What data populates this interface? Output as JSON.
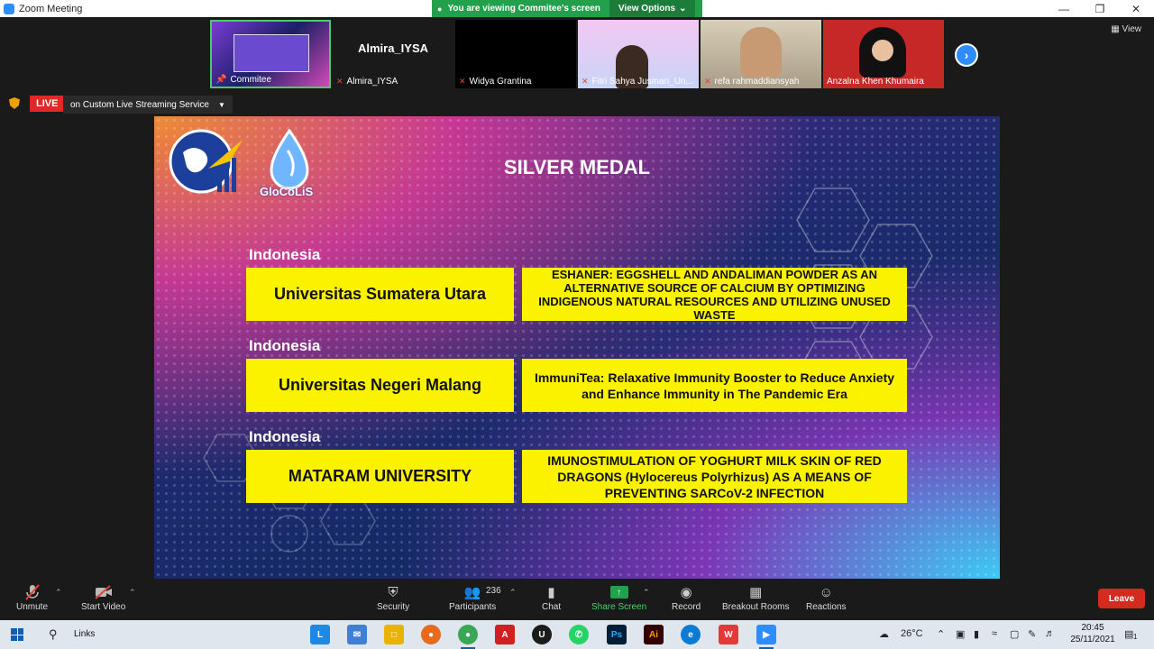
{
  "window": {
    "title": "Zoom Meeting"
  },
  "banner": {
    "text": "You are viewing Commitee's screen",
    "view_options": "View Options"
  },
  "strip": {
    "view_label": "View",
    "participants": [
      {
        "name": "Commitee",
        "muted": false
      },
      {
        "name": "Almira_IYSA",
        "big_name": "Almira_IYSA",
        "muted": true
      },
      {
        "name": "Widya Grantina",
        "muted": true
      },
      {
        "name": "Fitri Sahya Jusman_Un...",
        "muted": true
      },
      {
        "name": "refa rahmaddiansyah",
        "muted": true
      },
      {
        "name": "Anzalna Khen Khumaira",
        "muted": false
      }
    ]
  },
  "live": {
    "badge": "LIVE",
    "service": "on Custom Live Streaming Service"
  },
  "slide": {
    "logo_text": "GloCoLiS",
    "heading": "SILVER MEDAL",
    "entries": [
      {
        "country": "Indonesia",
        "university": "Universitas Sumatera Utara",
        "project": "ESHANER: EGGSHELL AND ANDALIMAN POWDER AS AN ALTERNATIVE SOURCE OF CALCIUM BY OPTIMIZING INDIGENOUS NATURAL RESOURCES AND UTILIZING UNUSED WASTE"
      },
      {
        "country": "Indonesia",
        "university": "Universitas Negeri Malang",
        "project": "ImmuniTea: Relaxative Immunity Booster to Reduce Anxiety and Enhance Immunity in The Pandemic Era"
      },
      {
        "country": "Indonesia",
        "university": "MATARAM UNIVERSITY",
        "project": "IMUNOSTIMULATION OF YOGHURT MILK SKIN OF RED DRAGONS (Hylocereus Polyrhizus) AS A MEANS OF PREVENTING SARCoV-2 INFECTION"
      }
    ]
  },
  "toolbar": {
    "unmute": "Unmute",
    "start_video": "Start Video",
    "security": "Security",
    "participants": "Participants",
    "participant_count": "236",
    "chat": "Chat",
    "share_screen": "Share Screen",
    "record": "Record",
    "breakout_rooms": "Breakout Rooms",
    "reactions": "Reactions",
    "leave": "Leave"
  },
  "taskbar": {
    "links": "Links",
    "temperature": "26°C",
    "time": "20:45",
    "date": "25/11/2021",
    "notification_count": "1"
  }
}
